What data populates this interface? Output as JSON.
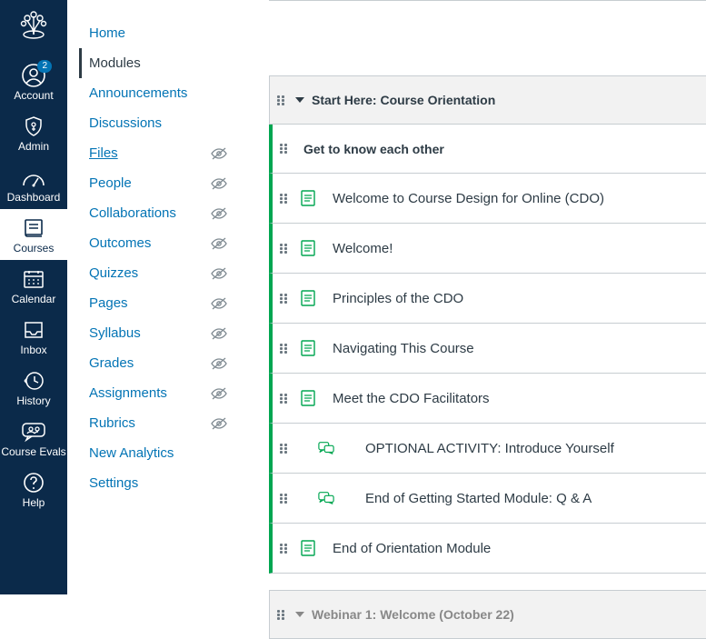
{
  "globalNav": {
    "items": [
      {
        "key": "account",
        "label": "Account",
        "badge": "2"
      },
      {
        "key": "admin",
        "label": "Admin"
      },
      {
        "key": "dashboard",
        "label": "Dashboard"
      },
      {
        "key": "courses",
        "label": "Courses",
        "active": true
      },
      {
        "key": "calendar",
        "label": "Calendar"
      },
      {
        "key": "inbox",
        "label": "Inbox"
      },
      {
        "key": "history",
        "label": "History"
      },
      {
        "key": "courseevals",
        "label": "Course Evals"
      },
      {
        "key": "help",
        "label": "Help"
      }
    ]
  },
  "courseNav": {
    "items": [
      {
        "label": "Home",
        "hidden": false
      },
      {
        "label": "Modules",
        "hidden": false,
        "active": true
      },
      {
        "label": "Announcements",
        "hidden": false
      },
      {
        "label": "Discussions",
        "hidden": false
      },
      {
        "label": "Files",
        "hidden": true,
        "underlined": true
      },
      {
        "label": "People",
        "hidden": true
      },
      {
        "label": "Collaborations",
        "hidden": true
      },
      {
        "label": "Outcomes",
        "hidden": true
      },
      {
        "label": "Quizzes",
        "hidden": true
      },
      {
        "label": "Pages",
        "hidden": true
      },
      {
        "label": "Syllabus",
        "hidden": true
      },
      {
        "label": "Grades",
        "hidden": true
      },
      {
        "label": "Assignments",
        "hidden": true
      },
      {
        "label": "Rubrics",
        "hidden": true
      },
      {
        "label": "New Analytics",
        "hidden": false
      },
      {
        "label": "Settings",
        "hidden": false
      }
    ]
  },
  "modules": {
    "header": "Start Here: Course Orientation",
    "subheader": "Get to know each other",
    "items": [
      {
        "type": "page",
        "title": "Welcome to Course Design for Online (CDO)"
      },
      {
        "type": "page",
        "title": "Welcome!"
      },
      {
        "type": "page",
        "title": "Principles of the CDO"
      },
      {
        "type": "page",
        "title": "Navigating This Course"
      },
      {
        "type": "page",
        "title": "Meet the CDO Facilitators"
      },
      {
        "type": "discussion",
        "title": "OPTIONAL ACTIVITY: Introduce Yourself",
        "indent": true
      },
      {
        "type": "discussion",
        "title": "End of Getting Started Module: Q & A",
        "indent": true
      },
      {
        "type": "page",
        "title": "End of Orientation Module"
      }
    ],
    "nextModule": "Webinar 1: Welcome (October 22)"
  }
}
